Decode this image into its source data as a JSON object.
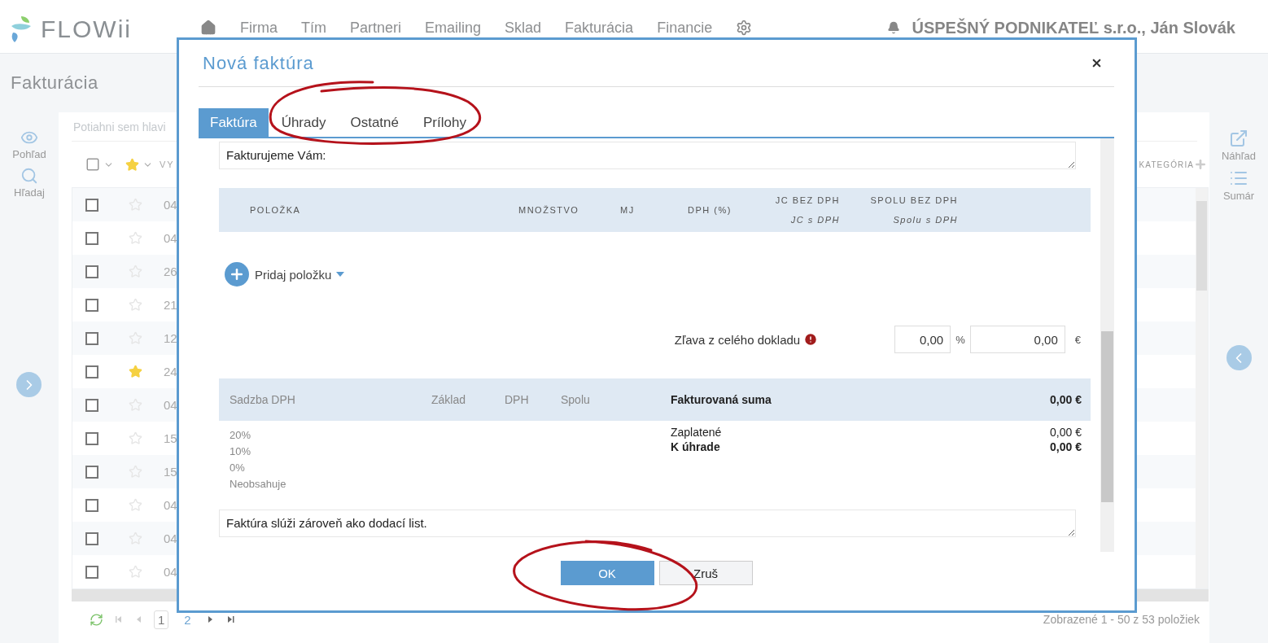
{
  "header": {
    "brand": "FLOWii",
    "nav": [
      "Firma",
      "Tím",
      "Partneri",
      "Emailing",
      "Sklad",
      "Fakturácia",
      "Financie"
    ],
    "account": "ÚSPEŠNÝ PODNIKATEĽ s.r.o., Ján Slovák"
  },
  "page_title": "Fakturácia",
  "left_tools": [
    "Pohľad",
    "Hľadaj"
  ],
  "right_tools": [
    "Náhľad",
    "Sumár"
  ],
  "list": {
    "drop_hint": "Potiahni sem hlavi",
    "column_3": "VY",
    "category": "KATEGÓRIA",
    "rows": [
      {
        "checked": false,
        "starred": false,
        "column_3": "04"
      },
      {
        "checked": false,
        "starred": false,
        "column_3": "04"
      },
      {
        "checked": false,
        "starred": false,
        "column_3": "26"
      },
      {
        "checked": false,
        "starred": false,
        "column_3": "21"
      },
      {
        "checked": false,
        "starred": false,
        "column_3": "12"
      },
      {
        "checked": false,
        "starred": true,
        "column_3": "24"
      },
      {
        "checked": false,
        "starred": false,
        "column_3": "04"
      },
      {
        "checked": false,
        "starred": false,
        "column_3": "15"
      },
      {
        "checked": false,
        "starred": false,
        "column_3": "15"
      },
      {
        "checked": false,
        "starred": false,
        "column_3": "04"
      },
      {
        "checked": false,
        "starred": false,
        "column_3": "04"
      },
      {
        "checked": false,
        "starred": false,
        "column_3": "04"
      }
    ],
    "pages": [
      {
        "label": "1",
        "selected": true
      },
      {
        "label": "2",
        "selected": false
      }
    ],
    "range": "Zobrazené 1 - 50 z 53 položiek"
  },
  "dialog": {
    "title": "Nová faktúra",
    "tabs": [
      {
        "label": "Faktúra",
        "selected": true
      },
      {
        "label": "Úhrady",
        "selected": false
      },
      {
        "label": "Ostatné",
        "selected": false
      },
      {
        "label": "Prílohy",
        "selected": false
      }
    ],
    "intro_text": "Fakturujeme Vám:",
    "item_columns": [
      {
        "label": "POLOŽKA"
      },
      {
        "label": "MNOŽSTVO"
      },
      {
        "label": "MJ"
      },
      {
        "label": "DPH (%)"
      },
      {
        "label": "JC BEZ DPH",
        "sublabel": "JC s DPH"
      },
      {
        "label": "SPOLU BEZ DPH",
        "sublabel": "Spolu s DPH"
      }
    ],
    "add_item": "Pridaj položku",
    "discount": {
      "label": "Zľava z celého dokladu",
      "percent": "0,00",
      "percent_unit": "%",
      "amount": "0,00",
      "currency": "€"
    },
    "vat_columns": [
      "Sadzba DPH",
      "Základ",
      "DPH",
      "Spolu"
    ],
    "invoiced": {
      "label": "Fakturovaná suma",
      "value": "0,00 €"
    },
    "vat_rates": [
      "20%",
      "10%",
      "0%",
      "Neobsahuje"
    ],
    "totals": [
      {
        "label": "Zaplatené",
        "value": "0,00 €",
        "bold": false
      },
      {
        "label": "K úhrade",
        "value": "0,00 €",
        "bold": true
      }
    ],
    "note_text": "Faktúra slúži zároveň ako dodací list.",
    "buttons": [
      {
        "label": "OK",
        "kind": "primary"
      },
      {
        "label": "Zruš",
        "kind": "secondary"
      }
    ]
  }
}
